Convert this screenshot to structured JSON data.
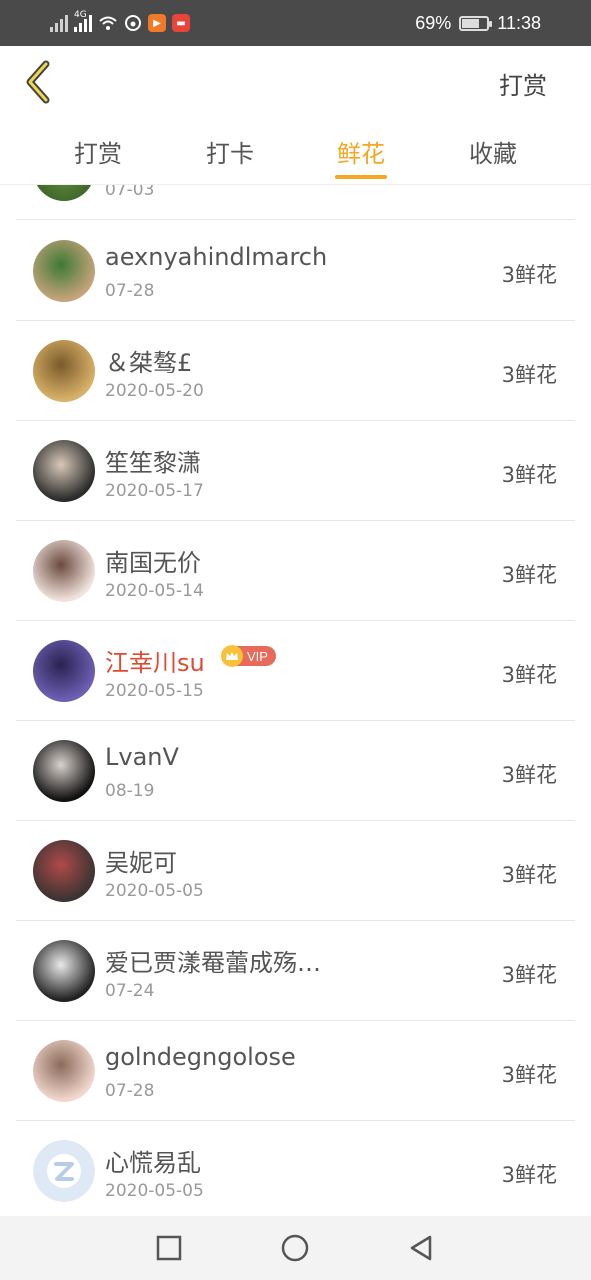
{
  "status_bar": {
    "network_label": "4G",
    "battery": "69%",
    "battery_level": 0.69,
    "time": "11:38",
    "apps": [
      {
        "icon": "cloud-music-icon",
        "color": "#4a4a4a"
      },
      {
        "icon": "video-app-icon",
        "color": "#f07a2a"
      },
      {
        "icon": "red-app-icon",
        "color": "#e8443a"
      }
    ]
  },
  "header": {
    "back_icon": "chevron-left-icon",
    "action_label": "打赏",
    "accent": "#f5a623"
  },
  "tabs": [
    {
      "label": "打赏",
      "active": false
    },
    {
      "label": "打卡",
      "active": false
    },
    {
      "label": "鲜花",
      "active": true
    },
    {
      "label": "收藏",
      "active": false
    }
  ],
  "list": {
    "partial_top": {
      "date": "07-03"
    },
    "rows": [
      {
        "name": "aexnyahindlmarch",
        "date": "07-28",
        "amount": "3鲜花",
        "vip": false,
        "avatar_colors": [
          "#c6a37a",
          "#3d7a35"
        ]
      },
      {
        "name": "＆桀骜£",
        "date": "2020-05-20",
        "amount": "3鲜花",
        "vip": false,
        "avatar_colors": [
          "#d8b169",
          "#7a5a2a"
        ]
      },
      {
        "name": "笙笙黎潇",
        "date": "2020-05-17",
        "amount": "3鲜花",
        "vip": false,
        "avatar_colors": [
          "#2b2b2b",
          "#d7c9b8"
        ]
      },
      {
        "name": "南国无价",
        "date": "2020-05-14",
        "amount": "3鲜花",
        "vip": false,
        "avatar_colors": [
          "#f0e2dc",
          "#6b4a3f"
        ]
      },
      {
        "name": "江幸川su",
        "date": "2020-05-15",
        "amount": "3鲜花",
        "vip": true,
        "vip_label": "VIP",
        "avatar_colors": [
          "#6d5fb3",
          "#2a2350"
        ]
      },
      {
        "name": "LvanV",
        "date": "08-19",
        "amount": "3鲜花",
        "vip": false,
        "avatar_colors": [
          "#111111",
          "#d9d2cd"
        ]
      },
      {
        "name": "吴妮可",
        "date": "2020-05-05",
        "amount": "3鲜花",
        "vip": false,
        "avatar_colors": [
          "#3a3432",
          "#b04a4a"
        ]
      },
      {
        "name": "爱已贾漾罨蕾成殇…",
        "date": "07-24",
        "amount": "3鲜花",
        "vip": false,
        "avatar_colors": [
          "#222222",
          "#e9e9e9"
        ]
      },
      {
        "name": "golndegngolose",
        "date": "07-28",
        "amount": "3鲜花",
        "vip": false,
        "avatar_colors": [
          "#f1d7cd",
          "#8a6a5a"
        ]
      },
      {
        "name": "心慌易乱",
        "date": "2020-05-05",
        "amount": "3鲜花",
        "vip": false,
        "avatar_colors": [
          "#dfe9f5",
          "#ffffff"
        ]
      }
    ]
  },
  "nav_bar": {
    "buttons": [
      "recent-apps-icon",
      "home-icon",
      "back-triangle-icon"
    ]
  }
}
